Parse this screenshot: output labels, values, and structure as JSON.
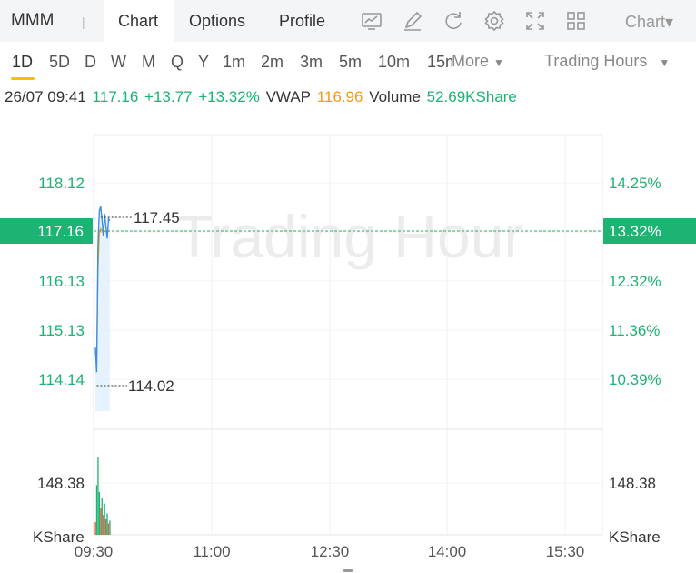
{
  "header": {
    "ticker": "MMM",
    "separator": "|",
    "tabs": [
      "Chart",
      "Options",
      "Profile"
    ],
    "chart_menu": "Chart▾",
    "icons": [
      "indicator-chart-icon",
      "draw-pencil-icon",
      "refresh-icon",
      "settings-gear-icon",
      "fullscreen-icon",
      "layout-grid-icon"
    ]
  },
  "periods": {
    "items": [
      "1D",
      "5D",
      "D",
      "W",
      "M",
      "Q",
      "Y",
      "1m",
      "2m",
      "3m",
      "5m",
      "10m",
      "15m"
    ],
    "selected": "1D",
    "more_label": "More",
    "trading_hours_label": "Trading Hours"
  },
  "info": {
    "datetime": "26/07 09:41",
    "price": "117.16",
    "change": "+13.77",
    "change_pct": "+13.32%",
    "vwap_label": "VWAP",
    "vwap": "116.96",
    "volume_label": "Volume",
    "volume": "52.69KShare"
  },
  "colors": {
    "up": "#1db372",
    "down": "#e8593c",
    "vwap": "#f39c12",
    "price_line": "#3d8ee8",
    "current_badge": "#1db372"
  },
  "chart_data": {
    "type": "line",
    "watermark": "Trading Hour",
    "x_ticks": [
      "09:30",
      "11:00",
      "12:30",
      "14:00",
      "15:30"
    ],
    "y_ticks_left": [
      "118.12",
      "116.13",
      "115.13",
      "114.14"
    ],
    "y_ticks_right": [
      "14.25%",
      "12.32%",
      "11.36%",
      "10.39%"
    ],
    "current_price_label": "117.16",
    "current_pct_label": "13.32%",
    "high_label": "117.45",
    "low_label": "114.02",
    "ylim": [
      113.5,
      118.9
    ],
    "price_series": {
      "x": [
        "09:30",
        "09:31",
        "09:32",
        "09:33",
        "09:34",
        "09:35",
        "09:36",
        "09:37",
        "09:38",
        "09:39",
        "09:40",
        "09:41"
      ],
      "values": [
        114.6,
        114.1,
        116.7,
        117.35,
        117.45,
        117.2,
        116.85,
        117.3,
        117.05,
        116.8,
        117.2,
        117.16
      ]
    },
    "vwap_series": {
      "x": [
        "09:30",
        "09:31",
        "09:32",
        "09:33",
        "09:34",
        "09:35",
        "09:36",
        "09:37",
        "09:38",
        "09:39",
        "09:40",
        "09:41"
      ],
      "values": [
        114.5,
        114.3,
        116.2,
        116.9,
        117.0,
        116.95,
        116.9,
        116.95,
        116.95,
        116.92,
        116.95,
        116.96
      ]
    },
    "volume": {
      "axis_label": "148.38",
      "unit_label": "KShare",
      "max": 148.38,
      "bars": [
        {
          "up": false,
          "v": 18
        },
        {
          "up": true,
          "v": 70
        },
        {
          "up": true,
          "v": 110
        },
        {
          "up": true,
          "v": 60
        },
        {
          "up": false,
          "v": 38
        },
        {
          "up": true,
          "v": 52
        },
        {
          "up": false,
          "v": 28
        },
        {
          "up": true,
          "v": 44
        },
        {
          "up": false,
          "v": 22
        },
        {
          "up": true,
          "v": 30
        },
        {
          "up": false,
          "v": 16
        },
        {
          "up": true,
          "v": 20
        }
      ]
    }
  }
}
